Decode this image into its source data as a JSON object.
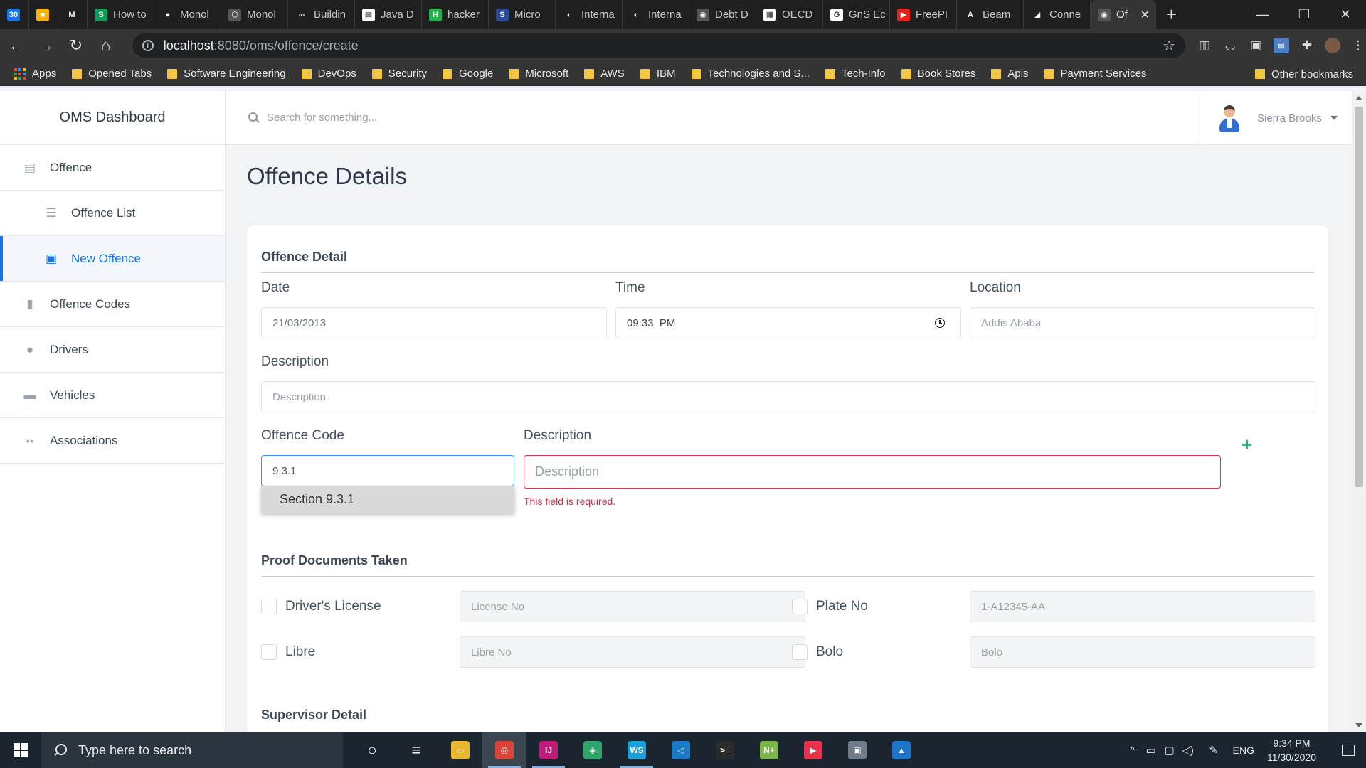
{
  "browser": {
    "tabs": [
      {
        "label": "",
        "color": "#1a73e8",
        "glyph": "30"
      },
      {
        "label": "",
        "color": "#f4b400",
        "glyph": "■"
      },
      {
        "label": "",
        "color": "#1f1f1f",
        "glyph": "M"
      },
      {
        "label": "How to",
        "color": "#0f9d58",
        "glyph": "S"
      },
      {
        "label": "Monol",
        "color": "#1f1f1f",
        "glyph": "●"
      },
      {
        "label": "Monol",
        "color": "#555555",
        "glyph": "⬡"
      },
      {
        "label": "Buildin",
        "color": "#1f1f1f",
        "glyph": "∞"
      },
      {
        "label": "Java D",
        "color": "#ffffff",
        "glyph": "▤"
      },
      {
        "label": "hacker",
        "color": "#22b14c",
        "glyph": "H"
      },
      {
        "label": "Micro",
        "color": "#2a4b9b",
        "glyph": "S"
      },
      {
        "label": "Interna",
        "color": "#1f1f1f",
        "glyph": "◐"
      },
      {
        "label": "Interna",
        "color": "#1f1f1f",
        "glyph": "◐"
      },
      {
        "label": "Debt D",
        "color": "#555555",
        "glyph": "◉"
      },
      {
        "label": "OECD",
        "color": "#ffffff",
        "glyph": "▦"
      },
      {
        "label": "GnS Ec",
        "color": "#ffffff",
        "glyph": "G"
      },
      {
        "label": "FreePI",
        "color": "#e62117",
        "glyph": "▶"
      },
      {
        "label": "Beam",
        "color": "#1f1f1f",
        "glyph": "A"
      },
      {
        "label": "Conne",
        "color": "#1f1f1f",
        "glyph": "◢"
      }
    ],
    "active_tab": {
      "label": "Of",
      "glyph": "◉"
    },
    "new_tab": "+",
    "url_host": "localhost",
    "url_path": ":8080/oms/offence/create",
    "bookmarks": [
      {
        "label": "Apps",
        "type": "apps"
      },
      {
        "label": "Opened Tabs",
        "type": "folder"
      },
      {
        "label": "Software Engineering",
        "type": "folder"
      },
      {
        "label": "DevOps",
        "type": "folder"
      },
      {
        "label": "Security",
        "type": "folder"
      },
      {
        "label": "Google",
        "type": "folder"
      },
      {
        "label": "Microsoft",
        "type": "folder"
      },
      {
        "label": "AWS",
        "type": "folder"
      },
      {
        "label": "IBM",
        "type": "folder"
      },
      {
        "label": "Technologies and S...",
        "type": "folder"
      },
      {
        "label": "Tech-Info",
        "type": "folder"
      },
      {
        "label": "Book Stores",
        "type": "folder"
      },
      {
        "label": "Apis",
        "type": "folder"
      },
      {
        "label": "Payment Services",
        "type": "folder"
      }
    ],
    "bookmarks_more": "»",
    "other_bookmarks": "Other bookmarks"
  },
  "app": {
    "brand": "OMS Dashboard",
    "search_placeholder": "Search for something...",
    "user_name": "Sierra Brooks",
    "sidebar": [
      {
        "label": "Offence",
        "icon": "document-icon",
        "sub": false,
        "active": false
      },
      {
        "label": "Offence List",
        "icon": "list-icon",
        "sub": true,
        "active": false
      },
      {
        "label": "New Offence",
        "icon": "add-document-icon",
        "sub": true,
        "active": true
      },
      {
        "label": "Offence Codes",
        "icon": "book-icon",
        "sub": false,
        "active": false
      },
      {
        "label": "Drivers",
        "icon": "person-icon",
        "sub": false,
        "active": false
      },
      {
        "label": "Vehicles",
        "icon": "car-icon",
        "sub": false,
        "active": false
      },
      {
        "label": "Associations",
        "icon": "people-icon",
        "sub": false,
        "active": false
      }
    ],
    "colors": {
      "accent": "#1a73e8",
      "error": "#c62f45",
      "add": "#2fb36d"
    }
  },
  "page": {
    "title": "Offence Details",
    "offence_detail": {
      "section_title": "Offence Detail",
      "date_label": "Date",
      "date_value": "21/03/2013",
      "time_label": "Time",
      "time_value": "09:33  PM",
      "location_label": "Location",
      "location_placeholder": "Addis Ababa",
      "description_label": "Description",
      "description_placeholder": "Description",
      "code_label": "Offence Code",
      "code_value": "9.3.1",
      "code_suggestion": "Section 9.3.1",
      "code_description_label": "Description",
      "code_description_placeholder": "Description",
      "code_description_error": "This field is required.",
      "add_symbol": "+"
    },
    "proof_documents": {
      "section_title": "Proof Documents Taken",
      "items": [
        {
          "label": "Driver's License",
          "placeholder": "License No"
        },
        {
          "label": "Plate No",
          "placeholder": "1-A12345-AA"
        },
        {
          "label": "Libre",
          "placeholder": "Libre No"
        },
        {
          "label": "Bolo",
          "placeholder": "Bolo"
        }
      ]
    },
    "supervisor": {
      "section_title": "Supervisor Detail"
    }
  },
  "taskbar": {
    "search_placeholder": "Type here to search",
    "apps": [
      {
        "name": "task-view-icon",
        "color": "#1b2530",
        "glyph": "○",
        "running": false
      },
      {
        "name": "timeline-icon",
        "color": "#1b2530",
        "glyph": "≡",
        "running": false
      },
      {
        "name": "file-explorer-icon",
        "color": "#e8b730",
        "glyph": "▭",
        "running": false
      },
      {
        "name": "chrome-icon",
        "color": "#db4437",
        "glyph": "◎",
        "running": true
      },
      {
        "name": "intellij-icon",
        "color": "#c21a7a",
        "glyph": "IJ",
        "running": true
      },
      {
        "name": "maps-icon",
        "color": "#2fa56b",
        "glyph": "◈",
        "running": false
      },
      {
        "name": "webstorm-icon",
        "color": "#1e9fd6",
        "glyph": "WS",
        "running": true
      },
      {
        "name": "vscode-icon",
        "color": "#1b7ac4",
        "glyph": "◁",
        "running": false
      },
      {
        "name": "terminal-icon",
        "color": "#2b2b2b",
        "glyph": ">_",
        "running": false
      },
      {
        "name": "notepad-plus-icon",
        "color": "#7ab648",
        "glyph": "N+",
        "running": false
      },
      {
        "name": "media-player-icon",
        "color": "#e8324d",
        "glyph": "▶",
        "running": false
      },
      {
        "name": "remote-desktop-icon",
        "color": "#6d7b8a",
        "glyph": "▣",
        "running": false
      },
      {
        "name": "photos-icon",
        "color": "#1e74c9",
        "glyph": "▲",
        "running": false
      }
    ],
    "language": "ENG",
    "time": "9:34 PM",
    "date": "11/30/2020"
  }
}
